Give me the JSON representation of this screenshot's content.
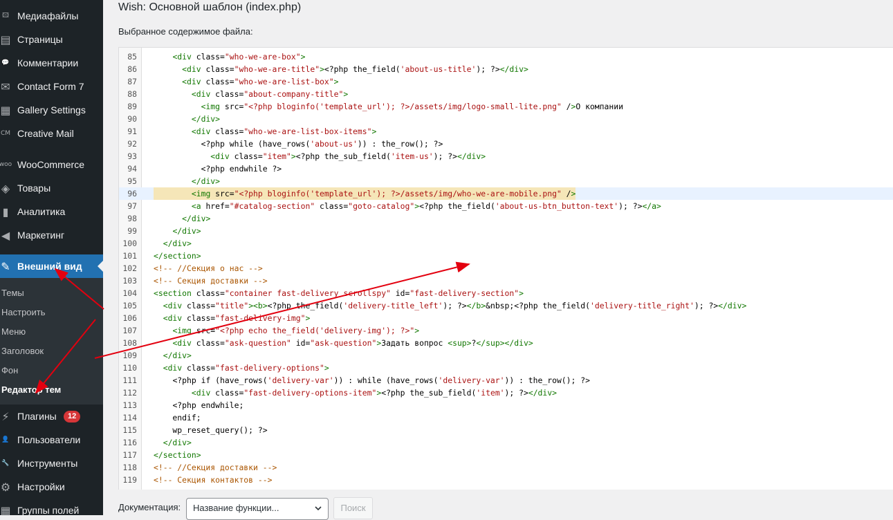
{
  "sidebar": {
    "items": [
      {
        "name": "media",
        "label": "Медиафайлы",
        "icon": "media-icon",
        "glyph": "🖾"
      },
      {
        "name": "pages",
        "label": "Страницы",
        "icon": "pages-icon",
        "glyph": "▤"
      },
      {
        "name": "comments",
        "label": "Комментарии",
        "icon": "comments-icon",
        "glyph": "💬"
      },
      {
        "name": "contact-form-7",
        "label": "Contact Form 7",
        "icon": "mail-icon",
        "glyph": "✉"
      },
      {
        "name": "gallery-settings",
        "label": "Gallery Settings",
        "icon": "gallery-icon",
        "glyph": "▦"
      },
      {
        "name": "creative-mail",
        "label": "Creative Mail",
        "icon": "cm-icon",
        "glyph": "CM"
      },
      {
        "name": "woocommerce",
        "label": "WooCommerce",
        "icon": "woo-icon",
        "glyph": "woo"
      },
      {
        "name": "products",
        "label": "Товары",
        "icon": "box-icon",
        "glyph": "◈"
      },
      {
        "name": "analytics",
        "label": "Аналитика",
        "icon": "bar-chart-icon",
        "glyph": "▮"
      },
      {
        "name": "marketing",
        "label": "Маркетинг",
        "icon": "megaphone-icon",
        "glyph": "◀"
      },
      {
        "name": "appearance",
        "label": "Внешний вид",
        "icon": "brush-icon",
        "glyph": "✎",
        "current": true
      },
      {
        "name": "plugins",
        "label": "Плагины",
        "icon": "plug-icon",
        "glyph": "⚡",
        "badge": "12"
      },
      {
        "name": "users",
        "label": "Пользователи",
        "icon": "user-icon",
        "glyph": "👤"
      },
      {
        "name": "tools",
        "label": "Инструменты",
        "icon": "wrench-icon",
        "glyph": "🔧"
      },
      {
        "name": "settings",
        "label": "Настройки",
        "icon": "settings-icon",
        "glyph": "⚙"
      },
      {
        "name": "field-groups",
        "label": "Группы полей",
        "icon": "fields-icon",
        "glyph": "▦"
      }
    ],
    "submenu": [
      {
        "name": "themes",
        "label": "Темы"
      },
      {
        "name": "customize",
        "label": "Настроить"
      },
      {
        "name": "menus",
        "label": "Меню"
      },
      {
        "name": "header",
        "label": "Заголовок"
      },
      {
        "name": "background",
        "label": "Фон"
      },
      {
        "name": "theme-editor",
        "label": "Редактор тем",
        "active": true
      }
    ]
  },
  "header": {
    "title": "Wish: Основной шаблон (index.php)",
    "file_label": "Выбранное содержимое файла:"
  },
  "editor": {
    "highlight_line": 96,
    "lines": [
      {
        "n": "85",
        "code": "    <div class=\"who-we-are-box\">"
      },
      {
        "n": "86",
        "code": "      <div class=\"who-we-are-title\"><?php the_field('about-us-title'); ?></div>"
      },
      {
        "n": "87",
        "code": "      <div class=\"who-we-are-list-box\">"
      },
      {
        "n": "88",
        "code": "        <div class=\"about-company-title\">"
      },
      {
        "n": "89",
        "code": "          <img src=\"<?php bloginfo('template_url'); ?>/assets/img/logo-small-lite.png\" />О компании"
      },
      {
        "n": "90",
        "code": "        </div>"
      },
      {
        "n": "91",
        "code": "        <div class=\"who-we-are-list-box-items\">"
      },
      {
        "n": "92",
        "code": "          <?php while (have_rows('about-us')) : the_row(); ?>"
      },
      {
        "n": "93",
        "code": "            <div class=\"item\"><?php the_sub_field('item-us'); ?></div>"
      },
      {
        "n": "94",
        "code": "          <?php endwhile ?>"
      },
      {
        "n": "95",
        "code": "        </div>"
      },
      {
        "n": "96",
        "code": "        <img src=\"<?php bloginfo('template_url'); ?>/assets/img/who-we-are-mobile.png\" />"
      },
      {
        "n": "97",
        "code": "        <a href=\"#catalog-section\" class=\"goto-catalog\"><?php the_field('about-us-btn_button-text'); ?></a>"
      },
      {
        "n": "98",
        "code": "      </div>"
      },
      {
        "n": "99",
        "code": "    </div>"
      },
      {
        "n": "100",
        "code": "  </div>"
      },
      {
        "n": "101",
        "code": "</section>"
      },
      {
        "n": "102",
        "code": "<!-- //Секция о нас -->"
      },
      {
        "n": "103",
        "code": "<!-- Секция доставки -->"
      },
      {
        "n": "104",
        "code": "<section class=\"container fast-delivery scrollspy\" id=\"fast-delivery-section\">"
      },
      {
        "n": "105",
        "code": "  <div class=\"title\"><b><?php the_field('delivery-title_left'); ?></b>&nbsp;<?php the_field('delivery-title_right'); ?></div>"
      },
      {
        "n": "106",
        "code": "  <div class=\"fast-delivery-img\">"
      },
      {
        "n": "107",
        "code": "    <img src=\"<?php echo the_field('delivery-img'); ?>\">"
      },
      {
        "n": "108",
        "code": "    <div class=\"ask-question\" id=\"ask-question\">Задать вопрос <sup>?</sup></div>"
      },
      {
        "n": "109",
        "code": "  </div>"
      },
      {
        "n": "110",
        "code": "  <div class=\"fast-delivery-options\">"
      },
      {
        "n": "111",
        "code": "    <?php if (have_rows('delivery-var')) : while (have_rows('delivery-var')) : the_row(); ?>"
      },
      {
        "n": "112",
        "code": "        <div class=\"fast-delivery-options-item\"><?php the_sub_field('item'); ?></div>"
      },
      {
        "n": "113",
        "code": "    <?php endwhile;"
      },
      {
        "n": "114",
        "code": "    endif;"
      },
      {
        "n": "115",
        "code": "    wp_reset_query(); ?>"
      },
      {
        "n": "116",
        "code": "  </div>"
      },
      {
        "n": "117",
        "code": "</section>"
      },
      {
        "n": "118",
        "code": "<!-- //Секция доставки -->"
      },
      {
        "n": "119",
        "code": "<!-- Секция контактов -->"
      }
    ]
  },
  "docbar": {
    "label": "Документация:",
    "select_placeholder": "Название функции...",
    "search_button": "Поиск"
  },
  "colors": {
    "sidebar_bg": "#1d2327",
    "accent": "#2271b1",
    "annotation_red": "#e3000f",
    "badge": "#d63638"
  }
}
